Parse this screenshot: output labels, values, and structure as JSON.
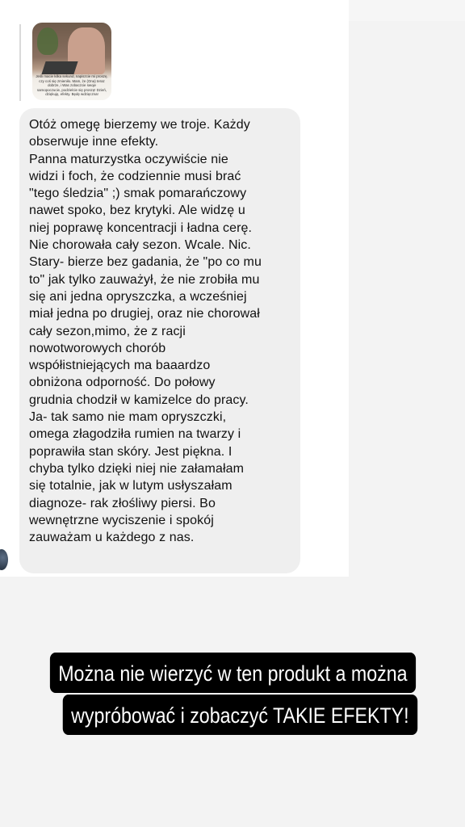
{
  "thumbnail": {
    "caption": "Jeśli macie kilka sekund, napiszcie mi proszę, czy coś się zmieniło. Mam, że (Ona) teraz dobrze, i Was zobaczcie swoje samopoczucie, podzielcie się proszę! Dzień, dziękuję, efekty. Będę wdzięczna!"
  },
  "message": {
    "text": "Otóż omegę bierzemy we troje. Każdy\nobserwuje inne efekty.\nPanna maturzystka oczywiście  nie\nwidzi i foch, że codziennie musi brać\n\"tego śledzia\" ;) smak pomarańczowy\nnawet spoko, bez krytyki. Ale widzę u\nniej poprawę koncentracji i ładna cerę.\nNie chorowała cały sezon. Wcale. Nic.\nStary- bierze bez gadania, że \"po co mu\nto\" jak tylko zauważył, że nie zrobiła mu\nsię ani jedna opryszczka, a wcześniej\nmiał jedna po drugiej, oraz nie chorował\ncały sezon,mimo, że z racji\nnowotworowych chorób\nwspółistniejących ma baaardzo\nobniżona odporność. Do połowy\ngrudnia chodził w kamizelce do pracy.\nJa- tak samo nie mam opryszczki,\nomega złagodziła rumien na twarzy i\npoprawiła stan skóry. Jest piękna. I\nchyba tylko dzięki niej nie załamałam\nsię totalnie, jak w lutym usłyszałam\ndiagnoze- rak złośliwy piersi. Bo\nwewnętrzne wyciszenie i spokój\nzauważam u każdego z nas."
  },
  "banner": {
    "line1": "Można nie wierzyć w ten produkt a można",
    "line2": "wypróbować i zobaczyć TAKIE EFEKTY!"
  },
  "colors": {
    "bubble": "#efefef",
    "banner_bg": "#000000",
    "banner_text": "#ffffff",
    "page_bg": "#f3f3f3"
  }
}
